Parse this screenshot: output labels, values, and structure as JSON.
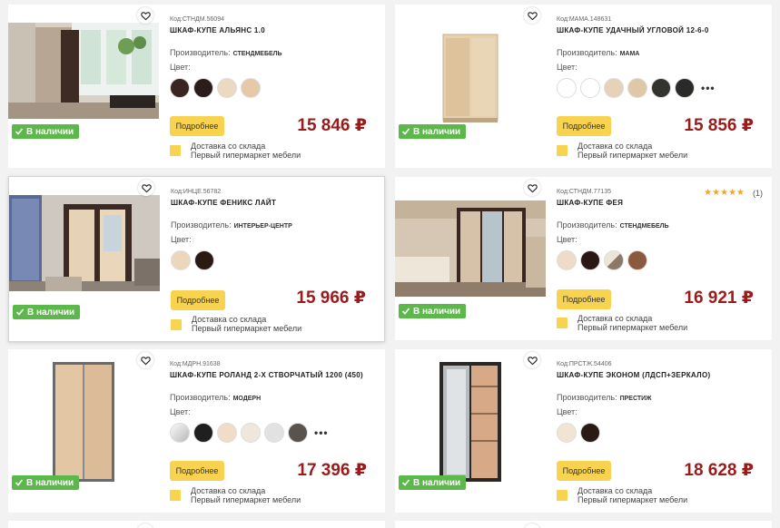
{
  "products": [
    {
      "code": "Код:СТНДМ.56094",
      "title": "ШКАФ-КУПЕ АЛЬЯНС 1.0",
      "maker_label": "Производитель:",
      "maker": "СТЕНДМЕБЕЛЬ",
      "color_label": "Цвет:",
      "swatches": [
        "#3a2522",
        "#2a1c1a",
        "#ecd9c2",
        "#e6c9a8"
      ],
      "has_more": false,
      "button": "Подробнее",
      "price": "15 846 ₽",
      "stock": "В наличии",
      "delivery_1": "Доставка со склада",
      "delivery_2": "Первый гипермаркет мебели"
    },
    {
      "code": "Код:МАМА.148631",
      "title": "ШКАФ-КУПЕ УДАЧНЫЙ УГЛОВОЙ 12-6-0",
      "maker_label": "Производитель:",
      "maker": "МАМА",
      "color_label": "Цвет:",
      "swatches": [
        "#ffffff",
        "#ffffff",
        "#e6d2b8",
        "#dfc8a8",
        "#333330",
        "#2a2a28"
      ],
      "has_more": true,
      "more": "•••",
      "button": "Подробнее",
      "price": "15 856 ₽",
      "stock": "В наличии",
      "delivery_1": "Доставка со склада",
      "delivery_2": "Первый гипермаркет мебели"
    },
    {
      "code": "Код:ИНЦЕ.56782",
      "title": "ШКАФ-КУПЕ ФЕНИКС ЛАЙТ",
      "maker_label": "Производитель:",
      "maker": "ИНТЕРЬЕР-ЦЕНТР",
      "color_label": "Цвет:",
      "swatches": [
        "#ecd7bd",
        "#2a1a14"
      ],
      "has_more": false,
      "button": "Подробнее",
      "price": "15 966 ₽",
      "stock": "В наличии",
      "delivery_1": "Доставка со склада",
      "delivery_2": "Первый гипермаркет мебели"
    },
    {
      "code": "Код:СТНДМ.77135",
      "title": "ШКАФ-КУПЕ ФЕЯ",
      "maker_label": "Производитель:",
      "maker": "СТЕНДМЕБЕЛЬ",
      "color_label": "Цвет:",
      "swatches": [
        "#ecdcc8",
        "#2b1815",
        "#a99888",
        "#8b5a3e"
      ],
      "has_more": false,
      "rating": "★★★★★",
      "rating_count": "(1)",
      "button": "Подробнее",
      "price": "16 921 ₽",
      "stock": "В наличии",
      "delivery_1": "Доставка со склада",
      "delivery_2": "Первый гипермаркет мебели"
    },
    {
      "code": "Код:МДРН.91638",
      "title": "ШКАФ-КУПЕ РОЛАНД 2-Х СТВОРЧАТЫЙ 1200 (450)",
      "maker_label": "Производитель:",
      "maker": "МОДЕРН",
      "color_label": "Цвет:",
      "swatches": [
        "#e0e0e0",
        "#1f1f1f",
        "#f0dcc8",
        "#efe6dc",
        "#e2e2e2",
        "#5a534d"
      ],
      "has_more": true,
      "more": "•••",
      "button": "Подробнее",
      "price": "17 396 ₽",
      "stock": "В наличии",
      "delivery_1": "Доставка со склада",
      "delivery_2": "Первый гипермаркет мебели"
    },
    {
      "code": "Код:ПРСТЖ.54406",
      "title": "ШКАФ-КУПЕ ЭКОНОМ (ЛДСП+ЗЕРКАЛО)",
      "maker_label": "Производитель:",
      "maker": "ПРЕСТИЖ",
      "color_label": "Цвет:",
      "swatches": [
        "#f0e4d2",
        "#2a1a16"
      ],
      "has_more": false,
      "button": "Подробнее",
      "price": "18 628 ₽",
      "stock": "В наличии",
      "delivery_1": "Доставка со склада",
      "delivery_2": "Первый гипермаркет мебели"
    }
  ],
  "colors": {
    "price": "#9b1b1b",
    "button": "#f8d34f",
    "stock": "#5cb84a"
  },
  "icons": {
    "favorite": "heart-icon",
    "stock": "check-icon",
    "delivery": "delivery-box-icon"
  }
}
